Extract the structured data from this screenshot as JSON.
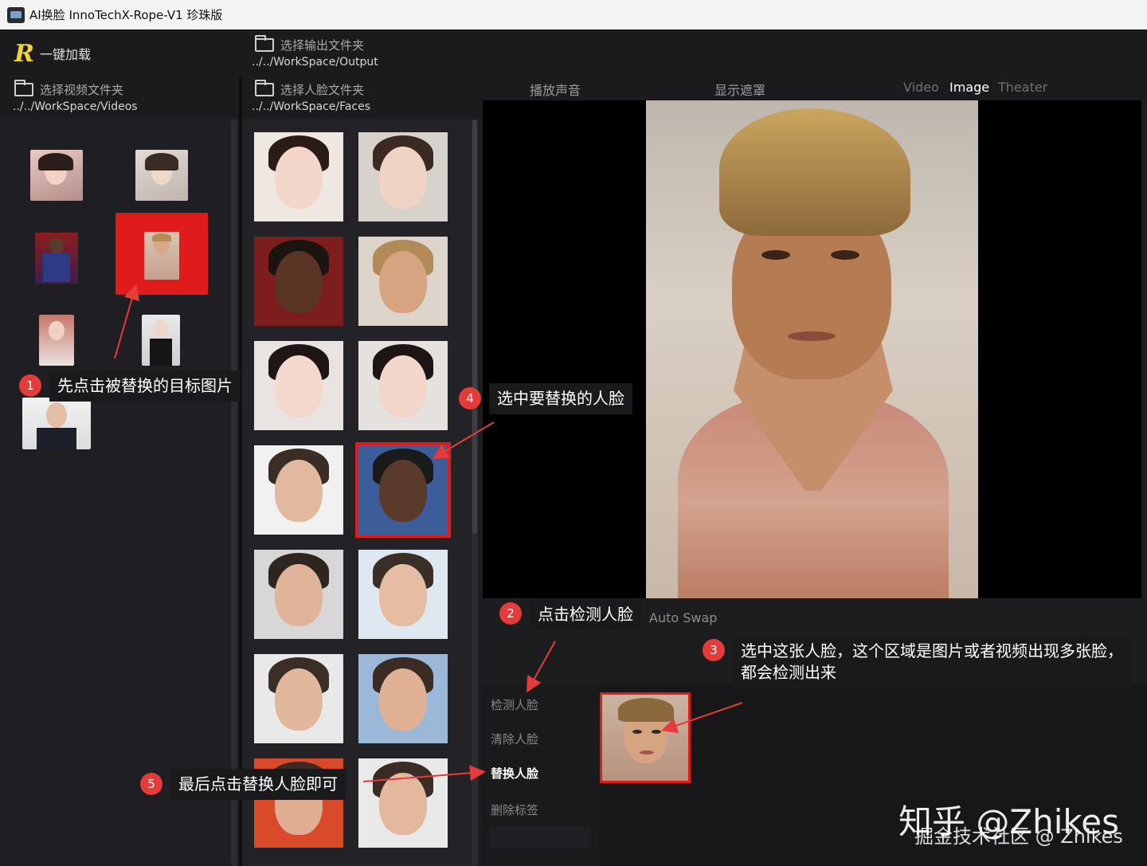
{
  "window": {
    "title": "AI换脸  InnoTechX-Rope-V1 珍珠版"
  },
  "toolbar": {
    "load_all": "一键加载",
    "output_folder_label": "选择输出文件夹",
    "output_folder_path": "../../WorkSpace/Output"
  },
  "videos": {
    "folder_label": "选择视频文件夹",
    "folder_path": "../../WorkSpace/Videos"
  },
  "faces": {
    "folder_label": "选择人脸文件夹",
    "folder_path": "../../WorkSpace/Faces"
  },
  "player": {
    "play_audio": "播放声音",
    "show_mask": "显示遮罩",
    "modes": [
      "Video",
      "Image",
      "Theater"
    ],
    "active_mode": "Image"
  },
  "swap_area": {
    "auto_swap": "Auto Swap",
    "buttons": [
      "检测人脸",
      "清除人脸",
      "替换人脸",
      "删除标签"
    ],
    "active_button": "替换人脸"
  },
  "annotations": [
    {
      "num": "1",
      "text": "先点击被替换的目标图片"
    },
    {
      "num": "2",
      "text": "点击检测人脸"
    },
    {
      "num": "3",
      "text": "选中这张人脸，这个区域是图片或者视频出现多张脸，都会检测出来"
    },
    {
      "num": "4",
      "text": "选中要替换的人脸"
    },
    {
      "num": "5",
      "text": "最后点击替换人脸即可"
    }
  ],
  "watermark": {
    "line1": "知乎 @Zhikes",
    "line2": "掘金技术社区 @ Zhikes"
  },
  "colors": {
    "accent": "#f2d23c",
    "selection": "#e01b1b",
    "badge": "#e43b3b"
  }
}
